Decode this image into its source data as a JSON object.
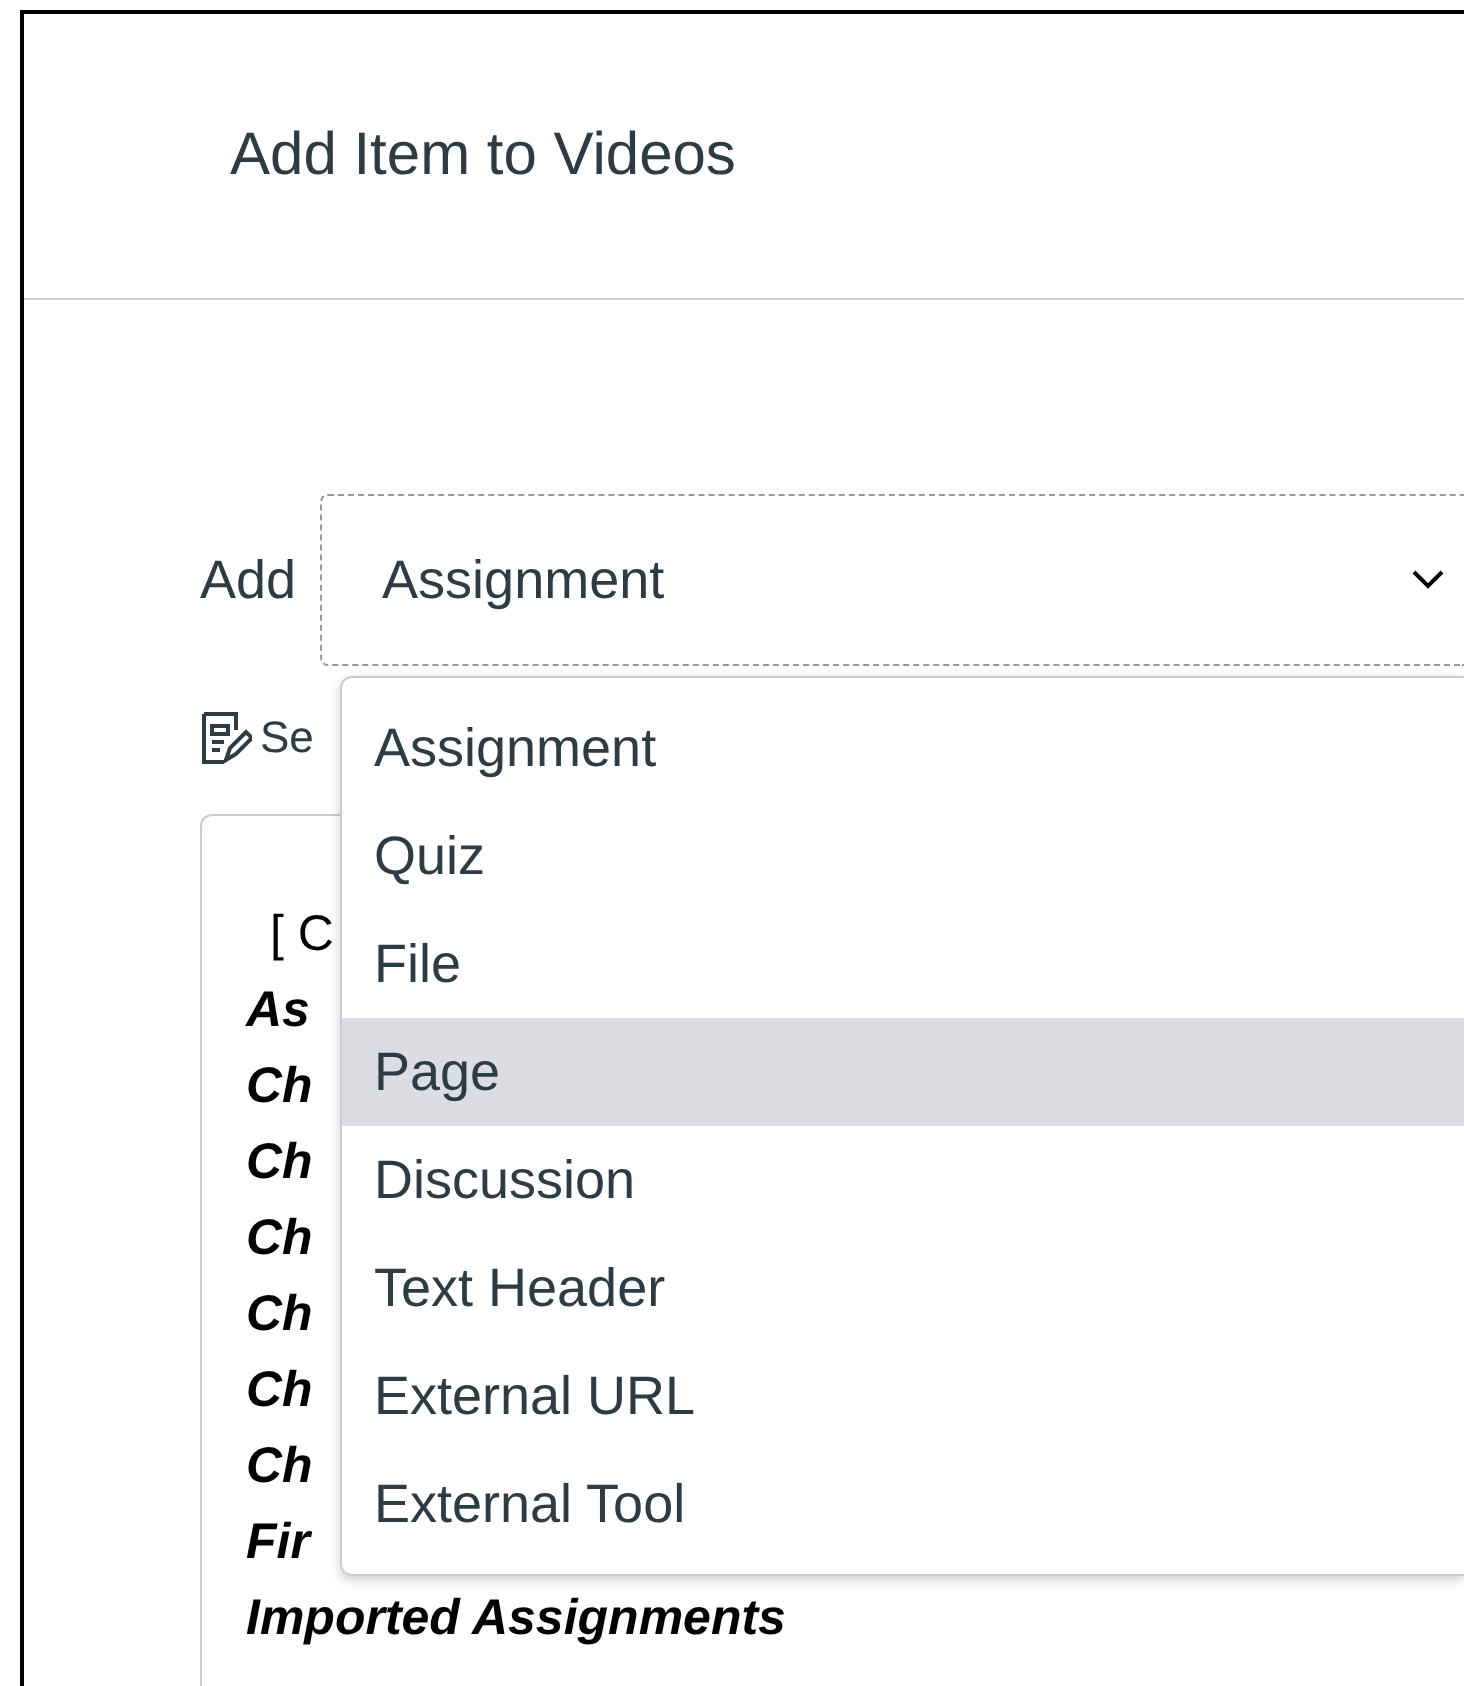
{
  "dialog": {
    "title": "Add Item to Videos"
  },
  "add_field": {
    "label": "Add",
    "value": "Assignment"
  },
  "select_link": {
    "text": "Se"
  },
  "list_box": {
    "items": [
      {
        "text": "[ C",
        "kind": "plain"
      },
      {
        "text": "As",
        "kind": "bold"
      },
      {
        "text": "Ch",
        "kind": "bold"
      },
      {
        "text": "Ch",
        "kind": "bold"
      },
      {
        "text": "Ch",
        "kind": "bold"
      },
      {
        "text": "Ch",
        "kind": "bold"
      },
      {
        "text": "Ch",
        "kind": "bold"
      },
      {
        "text": "Ch",
        "kind": "bold"
      },
      {
        "text": "Fir",
        "kind": "bold"
      },
      {
        "text": "Imported Assignments",
        "kind": "bold"
      }
    ]
  },
  "dropdown": {
    "options": [
      {
        "label": "Assignment",
        "selected": false
      },
      {
        "label": "Quiz",
        "selected": false
      },
      {
        "label": "File",
        "selected": false
      },
      {
        "label": "Page",
        "selected": true
      },
      {
        "label": "Discussion",
        "selected": false
      },
      {
        "label": "Text Header",
        "selected": false
      },
      {
        "label": "External URL",
        "selected": false
      },
      {
        "label": "External Tool",
        "selected": false
      }
    ]
  }
}
